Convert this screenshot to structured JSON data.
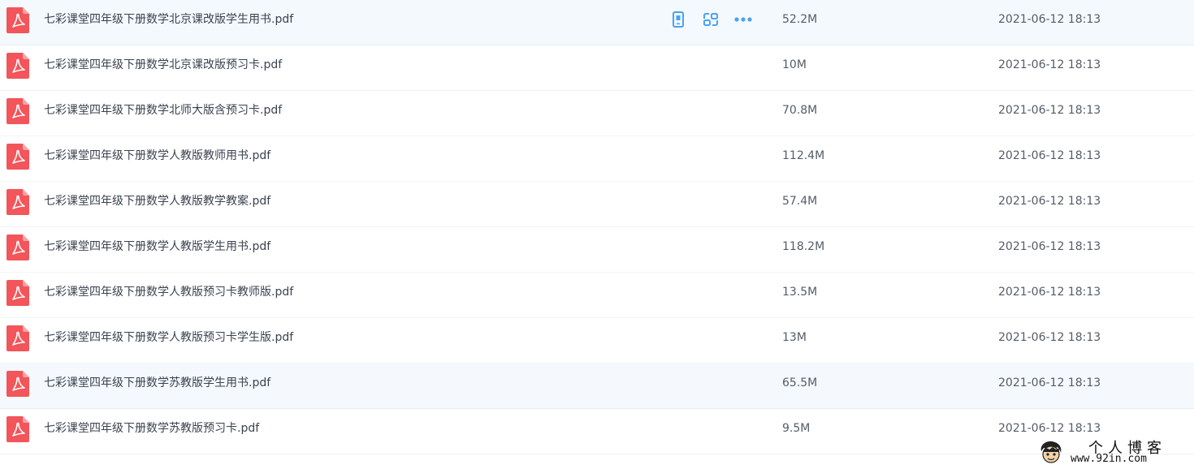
{
  "files": [
    {
      "name": "七彩课堂四年级下册数学北京课改版学生用书.pdf",
      "size": "52.2M",
      "date": "2021-06-12 18:13",
      "icon": "pdf-icon",
      "hovered": true
    },
    {
      "name": "七彩课堂四年级下册数学北京课改版预习卡.pdf",
      "size": "10M",
      "date": "2021-06-12 18:13",
      "icon": "pdf-icon"
    },
    {
      "name": "七彩课堂四年级下册数学北师大版含预习卡.pdf",
      "size": "70.8M",
      "date": "2021-06-12 18:13",
      "icon": "pdf-icon"
    },
    {
      "name": "七彩课堂四年级下册数学人教版教师用书.pdf",
      "size": "112.4M",
      "date": "2021-06-12 18:13",
      "icon": "pdf-icon"
    },
    {
      "name": "七彩课堂四年级下册数学人教版教学教案.pdf",
      "size": "57.4M",
      "date": "2021-06-12 18:13",
      "icon": "pdf-icon"
    },
    {
      "name": "七彩课堂四年级下册数学人教版学生用书.pdf",
      "size": "118.2M",
      "date": "2021-06-12 18:13",
      "icon": "pdf-icon"
    },
    {
      "name": "七彩课堂四年级下册数学人教版预习卡教师版.pdf",
      "size": "13.5M",
      "date": "2021-06-12 18:13",
      "icon": "pdf-icon"
    },
    {
      "name": "七彩课堂四年级下册数学人教版预习卡学生版.pdf",
      "size": "13M",
      "date": "2021-06-12 18:13",
      "icon": "pdf-icon"
    },
    {
      "name": "七彩课堂四年级下册数学苏教版学生用书.pdf",
      "size": "65.5M",
      "date": "2021-06-12 18:13",
      "icon": "pdf-icon"
    },
    {
      "name": "七彩课堂四年级下册数学苏教版预习卡.pdf",
      "size": "9.5M",
      "date": "2021-06-12 18:13",
      "icon": "pdf-icon"
    }
  ],
  "row_actions": [
    {
      "icon": "phone-icon"
    },
    {
      "icon": "share-link-icon"
    },
    {
      "icon": "more-icon"
    }
  ],
  "watermark": {
    "title": "个人博客",
    "url": "www.92in.com"
  },
  "colors": {
    "pdf_red": "#f2555a",
    "action_blue": "#4aa3f0",
    "hover_bg": "#f4f9fe"
  }
}
